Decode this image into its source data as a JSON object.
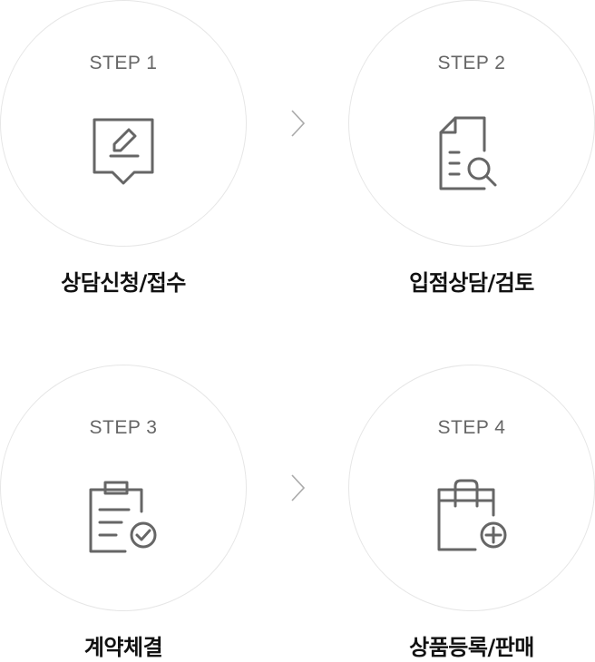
{
  "steps": [
    {
      "label": "STEP 1",
      "title": "상담신청/접수",
      "icon": "edit-speech-bubble-icon"
    },
    {
      "label": "STEP 2",
      "title": "입점상담/검토",
      "icon": "document-search-icon"
    },
    {
      "label": "STEP 3",
      "title": "계약체결",
      "icon": "clipboard-check-icon"
    },
    {
      "label": "STEP 4",
      "title": "상품등록/판매",
      "icon": "shopping-bag-add-icon"
    }
  ],
  "colors": {
    "icon_stroke": "#666666",
    "circle_border": "#e6e6e6",
    "step_label": "#666666",
    "title": "#111111",
    "arrow": "#aaaaaa"
  }
}
